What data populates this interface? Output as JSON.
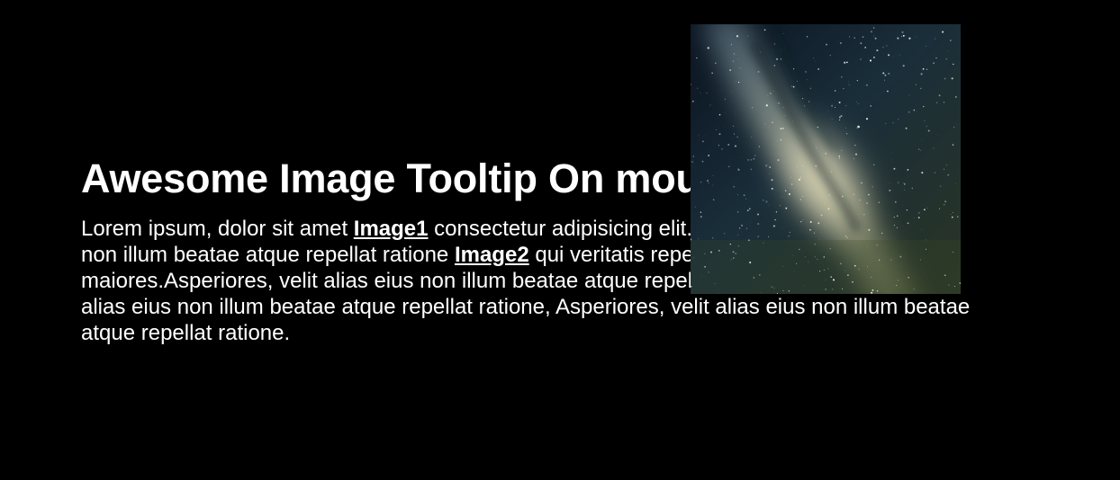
{
  "page": {
    "title": "Awesome Image Tooltip On mouse hover"
  },
  "paragraph": {
    "seg1": "Lorem ipsum, dolor sit amet ",
    "link1": "Image1",
    "seg2": " consectetur adipisicing elit. Asperiores, velit alias eius non illum beatae atque repellat ratione ",
    "link2": "Image2",
    "seg3": " qui veritatis repellendus adipisci maiores.Asperiores, velit alias eius non illum beatae atque repellat ratione, Asperiores, velit alias eius non illum beatae atque repellat ratione, Asperiores, velit alias eius non illum beatae atque repellat ratione."
  },
  "tooltip": {
    "image": "milky-way-night-sky",
    "visible": true
  },
  "colors": {
    "background": "#000000",
    "text": "#ffffff"
  }
}
